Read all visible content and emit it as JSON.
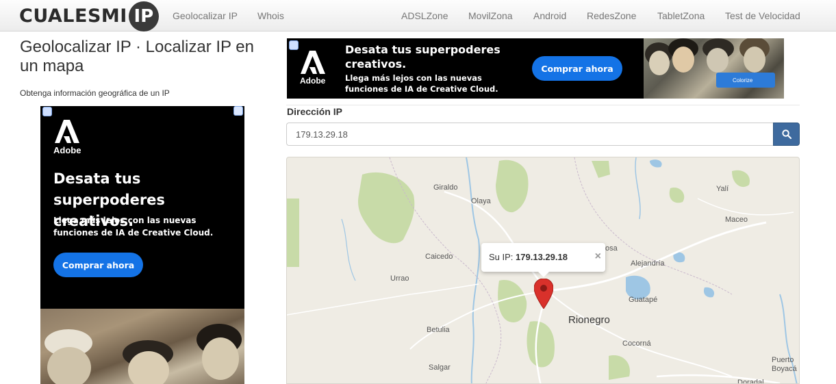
{
  "header": {
    "logo_text": "CUALESMI",
    "logo_badge": "IP",
    "nav_left": [
      "Geolocalizar IP",
      "Whois"
    ],
    "nav_right": [
      "ADSLZone",
      "MovilZona",
      "Android",
      "RedesZone",
      "TabletZona",
      "Test de Velocidad"
    ]
  },
  "page": {
    "title": "Geolocalizar IP · Localizar IP en un mapa",
    "subtitle": "Obtenga información geográfica de un IP"
  },
  "ad_top": {
    "brand": "Adobe",
    "headline": "Desata tus superpoderes creativos.",
    "subtext": "Llega más lejos con las nuevas funciones de IA de Creative Cloud.",
    "button": "Comprar ahora",
    "tag": "Colorize"
  },
  "ad_left": {
    "brand": "Adobe",
    "headline": "Desata tus superpoderes creativos.",
    "subtext": "Llega más lejos con las nuevas funciones de IA de Creative Cloud.",
    "button": "Comprar ahora"
  },
  "form": {
    "label": "Dirección IP",
    "ip_value": "179.13.29.18",
    "search_icon": "search-icon"
  },
  "map": {
    "popup_prefix": "Su IP:",
    "popup_ip": "179.13.29.18",
    "popup_close": "×",
    "places": [
      "Giraldo",
      "Olaya",
      "Yalí",
      "Maceo",
      "Caicedo",
      "Urrao",
      "osa",
      "Alejandría",
      "Guatapé",
      "Rionegro",
      "Betulia",
      "Cocorná",
      "Salgar",
      "Puerto Boyacá",
      "Doradal"
    ],
    "colors": {
      "land": "#efece4",
      "park": "#c8dba8",
      "water": "#9ec6e4",
      "road": "#ffffff",
      "marker": "#d9312b"
    }
  }
}
